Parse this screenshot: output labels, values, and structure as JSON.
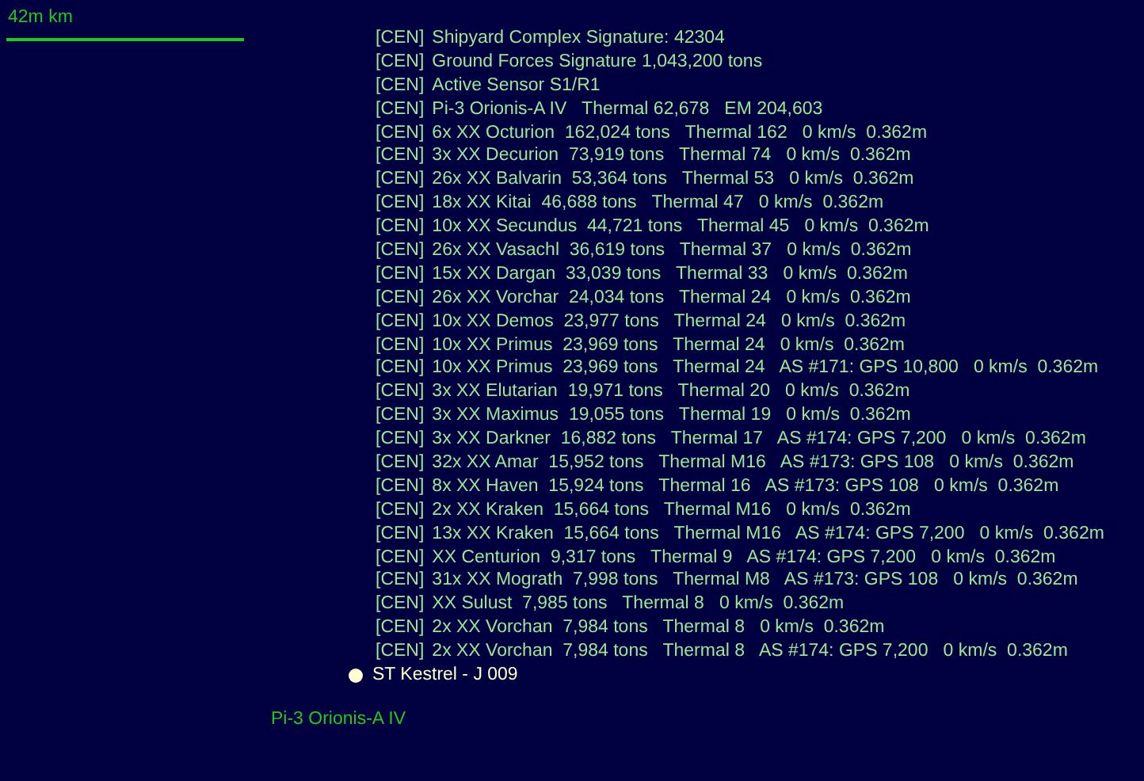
{
  "scale_bar": {
    "label": "42m km"
  },
  "contacts": [
    {
      "tag": "[CEN]",
      "text": "Shipyard Complex Signature: 42304"
    },
    {
      "tag": "[CEN]",
      "text": "Ground Forces Signature 1,043,200 tons"
    },
    {
      "tag": "[CEN]",
      "text": "Active Sensor S1/R1"
    },
    {
      "tag": "[CEN]",
      "text": "Pi-3 Orionis-A IV   Thermal 62,678   EM 204,603"
    },
    {
      "tag": "[CEN]",
      "text": "6x XX Octurion  162,024 tons   Thermal 162   0 km/s  0.362m"
    },
    {
      "tag": "[CEN]",
      "text": "3x XX Decurion  73,919 tons   Thermal 74   0 km/s  0.362m"
    },
    {
      "tag": "[CEN]",
      "text": "26x XX Balvarin  53,364 tons   Thermal 53   0 km/s  0.362m"
    },
    {
      "tag": "[CEN]",
      "text": "18x XX Kitai  46,688 tons   Thermal 47   0 km/s  0.362m"
    },
    {
      "tag": "[CEN]",
      "text": "10x XX Secundus  44,721 tons   Thermal 45   0 km/s  0.362m"
    },
    {
      "tag": "[CEN]",
      "text": "26x XX Vasachl  36,619 tons   Thermal 37   0 km/s  0.362m"
    },
    {
      "tag": "[CEN]",
      "text": "15x XX Dargan  33,039 tons   Thermal 33   0 km/s  0.362m"
    },
    {
      "tag": "[CEN]",
      "text": "26x XX Vorchar  24,034 tons   Thermal 24   0 km/s  0.362m"
    },
    {
      "tag": "[CEN]",
      "text": "10x XX Demos  23,977 tons   Thermal 24   0 km/s  0.362m"
    },
    {
      "tag": "[CEN]",
      "text": "10x XX Primus  23,969 tons   Thermal 24   0 km/s  0.362m"
    },
    {
      "tag": "[CEN]",
      "text": "10x XX Primus  23,969 tons   Thermal 24   AS #171: GPS 10,800   0 km/s  0.362m"
    },
    {
      "tag": "[CEN]",
      "text": "3x XX Elutarian  19,971 tons   Thermal 20   0 km/s  0.362m"
    },
    {
      "tag": "[CEN]",
      "text": "3x XX Maximus  19,055 tons   Thermal 19   0 km/s  0.362m"
    },
    {
      "tag": "[CEN]",
      "text": "3x XX Darkner  16,882 tons   Thermal 17   AS #174: GPS 7,200   0 km/s  0.362m"
    },
    {
      "tag": "[CEN]",
      "text": "32x XX Amar  15,952 tons   Thermal M16   AS #173: GPS 108   0 km/s  0.362m"
    },
    {
      "tag": "[CEN]",
      "text": "8x XX Haven  15,924 tons   Thermal 16   AS #173: GPS 108   0 km/s  0.362m"
    },
    {
      "tag": "[CEN]",
      "text": "2x XX Kraken  15,664 tons   Thermal M16   0 km/s  0.362m"
    },
    {
      "tag": "[CEN]",
      "text": "13x XX Kraken  15,664 tons   Thermal M16   AS #174: GPS 7,200   0 km/s  0.362m"
    },
    {
      "tag": "[CEN]",
      "text": "XX Centurion  9,317 tons   Thermal 9   AS #174: GPS 7,200   0 km/s  0.362m"
    },
    {
      "tag": "[CEN]",
      "text": "31x XX Mograth  7,998 tons   Thermal M8   AS #173: GPS 108   0 km/s  0.362m"
    },
    {
      "tag": "[CEN]",
      "text": "XX Sulust  7,985 tons   Thermal 8   0 km/s  0.362m"
    },
    {
      "tag": "[CEN]",
      "text": "2x XX Vorchan  7,984 tons   Thermal 8   0 km/s  0.362m"
    },
    {
      "tag": "[CEN]",
      "text": "2x XX Vorchan  7,984 tons   Thermal 8   AS #174: GPS 7,200   0 km/s  0.362m"
    }
  ],
  "fleet": {
    "name": "ST Kestrel - J 009"
  },
  "body": {
    "name": "Pi-3 Orionis-A IV"
  }
}
